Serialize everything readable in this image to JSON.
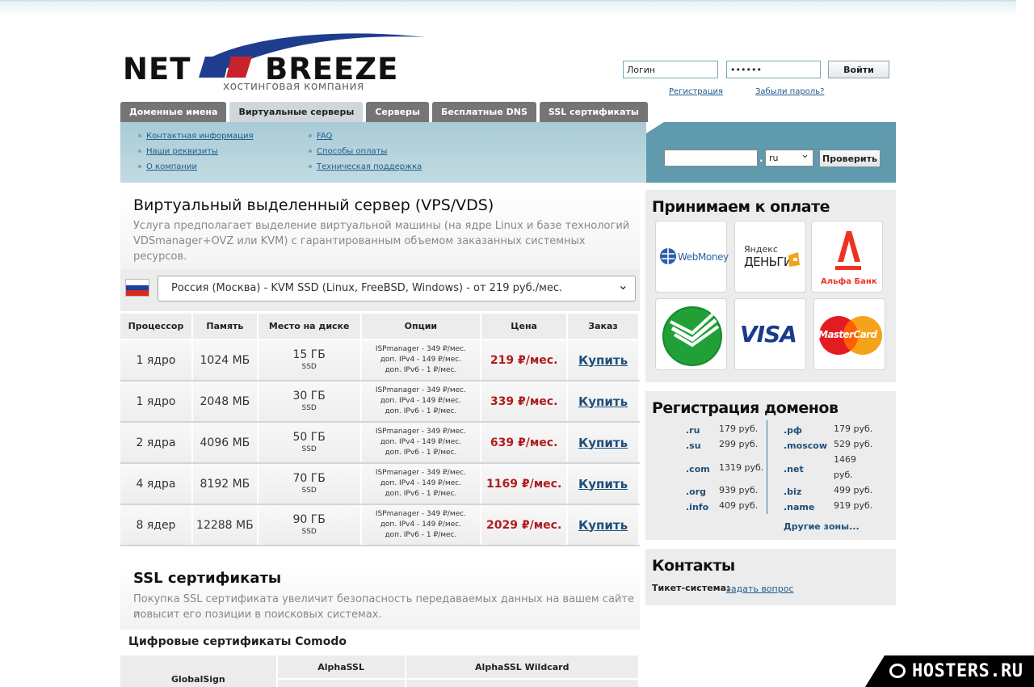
{
  "logo": {
    "word1": "NET",
    "word2": "BREEZE",
    "tagline": "хостинговая компания"
  },
  "login": {
    "login_value": "Логин",
    "password_value": "••••••",
    "submit_label": "Войти",
    "register_link": "Регистрация",
    "forgot_link": "Забыли пароль?"
  },
  "tabs": [
    {
      "label": "Доменные имена",
      "active": true
    },
    {
      "label": "Виртуальные серверы",
      "active": true
    },
    {
      "label": "Серверы",
      "active": false
    },
    {
      "label": "Бесплатные DNS",
      "active": false
    },
    {
      "label": "SSL сертификаты",
      "active": false
    }
  ],
  "subnav": {
    "col1": [
      "Контактная информация",
      "Наши реквизиты",
      "О компании"
    ],
    "col2": [
      "FAQ",
      "Способы оплаты",
      "Техническая поддержка"
    ]
  },
  "domain_search": {
    "dot": ".",
    "zone": "ru",
    "button": "Проверить"
  },
  "vps": {
    "title": "Виртуальный выделенный сервер (VPS/VDS)",
    "description_line1": "Услуга предполагает выделение виртуальной машины (на ядре Linux и базе технологий",
    "description_line2": "VDSmanager+OVZ или KVM) с гарантированным объемом заказанных системных ресурсов.",
    "plan_selected": "Россия (Москва) - KVM SSD (Linux, FreeBSD, Windows) - от 219 руб./мес.",
    "headers": [
      "Процессор",
      "Память",
      "Место на диске",
      "Опции",
      "Цена",
      "Заказ"
    ],
    "rows": [
      {
        "cpu": "1 ядро",
        "ram": "1024 МБ",
        "disk": "15 ГБ",
        "disk_type": "SSD",
        "opt1": "ISPmanager - 349 ₽/мес.",
        "opt2": "доп. IPv4 - 149 ₽/мес.",
        "opt3": "доп. IPv6 - 1 ₽/мес.",
        "price": "219 ₽/мес.",
        "buy": "Купить"
      },
      {
        "cpu": "1 ядро",
        "ram": "2048 МБ",
        "disk": "30 ГБ",
        "disk_type": "SSD",
        "opt1": "ISPmanager - 349 ₽/мес.",
        "opt2": "доп. IPv4 - 149 ₽/мес.",
        "opt3": "доп. IPv6 - 1 ₽/мес.",
        "price": "339 ₽/мес.",
        "buy": "Купить"
      },
      {
        "cpu": "2 ядра",
        "ram": "4096 МБ",
        "disk": "50 ГБ",
        "disk_type": "SSD",
        "opt1": "ISPmanager - 349 ₽/мес.",
        "opt2": "доп. IPv4 - 149 ₽/мес.",
        "opt3": "доп. IPv6 - 1 ₽/мес.",
        "price": "639 ₽/мес.",
        "buy": "Купить"
      },
      {
        "cpu": "4 ядра",
        "ram": "8192 МБ",
        "disk": "70 ГБ",
        "disk_type": "SSD",
        "opt1": "ISPmanager - 349 ₽/мес.",
        "opt2": "доп. IPv4 - 149 ₽/мес.",
        "opt3": "доп. IPv6 - 1 ₽/мес.",
        "price": "1169 ₽/мес.",
        "buy": "Купить"
      },
      {
        "cpu": "8 ядер",
        "ram": "12288 МБ",
        "disk": "90 ГБ",
        "disk_type": "SSD",
        "opt1": "ISPmanager - 349 ₽/мес.",
        "opt2": "доп. IPv4 - 149 ₽/мес.",
        "opt3": "доп. IPv6 - 1 ₽/мес.",
        "price": "2029 ₽/мес.",
        "buy": "Купить"
      }
    ]
  },
  "ssl": {
    "title": "SSL сертификаты",
    "description_line1": "Покупка SSL сертификата увеличит безопасность передаваемых данных на вашем сайте и",
    "description_line2": "повысит его позиции в поисковых системах.",
    "comodo_title": "Цифровые сертификаты Comodo",
    "col_globalsign": "GlobalSign",
    "col_alphassl": "AlphaSSL",
    "col_wildcard": "AlphaSSL Wildcard"
  },
  "payment": {
    "title": "Принимаем к оплате",
    "webmoney": "WebMoney",
    "yandex_top": "Яндекс",
    "yandex_bottom": "ДЕНЬГИ",
    "alfa": "Альфа Банк",
    "visa": "VISA",
    "mastercard": "MasterCard"
  },
  "domains": {
    "title": "Регистрация доменов",
    "left": [
      {
        "zone": ".ru",
        "price": "179 руб."
      },
      {
        "zone": ".su",
        "price": "299 руб."
      },
      {
        "zone": ".com",
        "price": "1319 руб."
      },
      {
        "zone": ".org",
        "price": "939 руб."
      },
      {
        "zone": ".info",
        "price": "409 руб."
      }
    ],
    "right": [
      {
        "zone": ".рф",
        "price": "179 руб."
      },
      {
        "zone": ".moscow",
        "price": "529 руб."
      },
      {
        "zone": ".net",
        "price_line1": "1469",
        "price_line2": "руб."
      },
      {
        "zone": ".biz",
        "price": "499 руб."
      },
      {
        "zone": ".name",
        "price": "919 руб."
      }
    ],
    "more": "Другие зоны..."
  },
  "contacts": {
    "title": "Контакты",
    "ticket_label": "Тикет-система:",
    "ticket_link": "задать вопрос"
  },
  "watermark": "HOSTERS.RU",
  "colors": {
    "accent_blue": "#1f4f7a",
    "price_red": "#b01c1c",
    "tab_gray": "#757575",
    "panel_teal": "#5f9aad"
  }
}
